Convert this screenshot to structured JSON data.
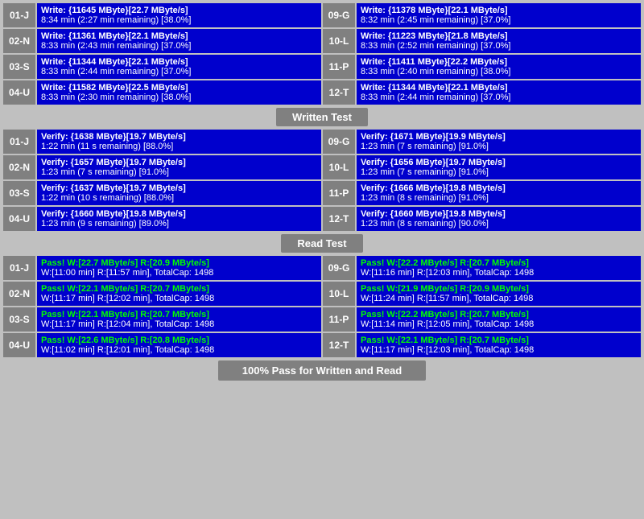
{
  "sections": {
    "write": {
      "rows": [
        {
          "left_label": "01-J",
          "left_line1": "Write: {11645 MByte}[22.7 MByte/s]",
          "left_line2": "8:34 min (2:27 min remaining)  [38.0%]",
          "right_label": "09-G",
          "right_line1": "Write: {11378 MByte}[22.1 MByte/s]",
          "right_line2": "8:32 min (2:45 min remaining)  [37.0%]"
        },
        {
          "left_label": "02-N",
          "left_line1": "Write: {11361 MByte}[22.1 MByte/s]",
          "left_line2": "8:33 min (2:43 min remaining)  [37.0%]",
          "right_label": "10-L",
          "right_line1": "Write: {11223 MByte}[21.8 MByte/s]",
          "right_line2": "8:33 min (2:52 min remaining)  [37.0%]"
        },
        {
          "left_label": "03-S",
          "left_line1": "Write: {11344 MByte}[22.1 MByte/s]",
          "left_line2": "8:33 min (2:44 min remaining)  [37.0%]",
          "right_label": "11-P",
          "right_line1": "Write: {11411 MByte}[22.2 MByte/s]",
          "right_line2": "8:33 min (2:40 min remaining)  [38.0%]"
        },
        {
          "left_label": "04-U",
          "left_line1": "Write: {11582 MByte}[22.5 MByte/s]",
          "left_line2": "8:33 min (2:30 min remaining)  [38.0%]",
          "right_label": "12-T",
          "right_line1": "Write: {11344 MByte}[22.1 MByte/s]",
          "right_line2": "8:33 min (2:44 min remaining)  [37.0%]"
        }
      ],
      "label": "Written Test"
    },
    "verify": {
      "rows": [
        {
          "left_label": "01-J",
          "left_line1": "Verify: {1638 MByte}[19.7 MByte/s]",
          "left_line2": "1:22 min (11 s remaining)  [88.0%]",
          "right_label": "09-G",
          "right_line1": "Verify: {1671 MByte}[19.9 MByte/s]",
          "right_line2": "1:23 min (7 s remaining)  [91.0%]"
        },
        {
          "left_label": "02-N",
          "left_line1": "Verify: {1657 MByte}[19.7 MByte/s]",
          "left_line2": "1:23 min (7 s remaining)  [91.0%]",
          "right_label": "10-L",
          "right_line1": "Verify: {1656 MByte}[19.7 MByte/s]",
          "right_line2": "1:23 min (7 s remaining)  [91.0%]"
        },
        {
          "left_label": "03-S",
          "left_line1": "Verify: {1637 MByte}[19.7 MByte/s]",
          "left_line2": "1:22 min (10 s remaining)  [88.0%]",
          "right_label": "11-P",
          "right_line1": "Verify: {1666 MByte}[19.8 MByte/s]",
          "right_line2": "1:23 min (8 s remaining)  [91.0%]"
        },
        {
          "left_label": "04-U",
          "left_line1": "Verify: {1660 MByte}[19.8 MByte/s]",
          "left_line2": "1:23 min (9 s remaining)  [89.0%]",
          "right_label": "12-T",
          "right_line1": "Verify: {1660 MByte}[19.8 MByte/s]",
          "right_line2": "1:23 min (8 s remaining)  [90.0%]"
        }
      ],
      "label": "Read Test"
    },
    "pass": {
      "rows": [
        {
          "left_label": "01-J",
          "left_line1": "Pass! W:[22.7 MByte/s] R:[20.9 MByte/s]",
          "left_line2": "W:[11:00 min] R:[11:57 min], TotalCap: 1498",
          "right_label": "09-G",
          "right_line1": "Pass! W:[22.2 MByte/s] R:[20.7 MByte/s]",
          "right_line2": "W:[11:16 min] R:[12:03 min], TotalCap: 1498"
        },
        {
          "left_label": "02-N",
          "left_line1": "Pass! W:[22.1 MByte/s] R:[20.7 MByte/s]",
          "left_line2": "W:[11:17 min] R:[12:02 min], TotalCap: 1498",
          "right_label": "10-L",
          "right_line1": "Pass! W:[21.9 MByte/s] R:[20.9 MByte/s]",
          "right_line2": "W:[11:24 min] R:[11:57 min], TotalCap: 1498"
        },
        {
          "left_label": "03-S",
          "left_line1": "Pass! W:[22.1 MByte/s] R:[20.7 MByte/s]",
          "left_line2": "W:[11:17 min] R:[12:04 min], TotalCap: 1498",
          "right_label": "11-P",
          "right_line1": "Pass! W:[22.2 MByte/s] R:[20.7 MByte/s]",
          "right_line2": "W:[11:14 min] R:[12:05 min], TotalCap: 1498"
        },
        {
          "left_label": "04-U",
          "left_line1": "Pass! W:[22.6 MByte/s] R:[20.8 MByte/s]",
          "left_line2": "W:[11:02 min] R:[12:01 min], TotalCap: 1498",
          "right_label": "12-T",
          "right_line1": "Pass! W:[22.1 MByte/s] R:[20.7 MByte/s]",
          "right_line2": "W:[11:17 min] R:[12:03 min], TotalCap: 1498"
        }
      ],
      "label": "Read Test"
    },
    "footer": "100% Pass for Written and Read"
  }
}
